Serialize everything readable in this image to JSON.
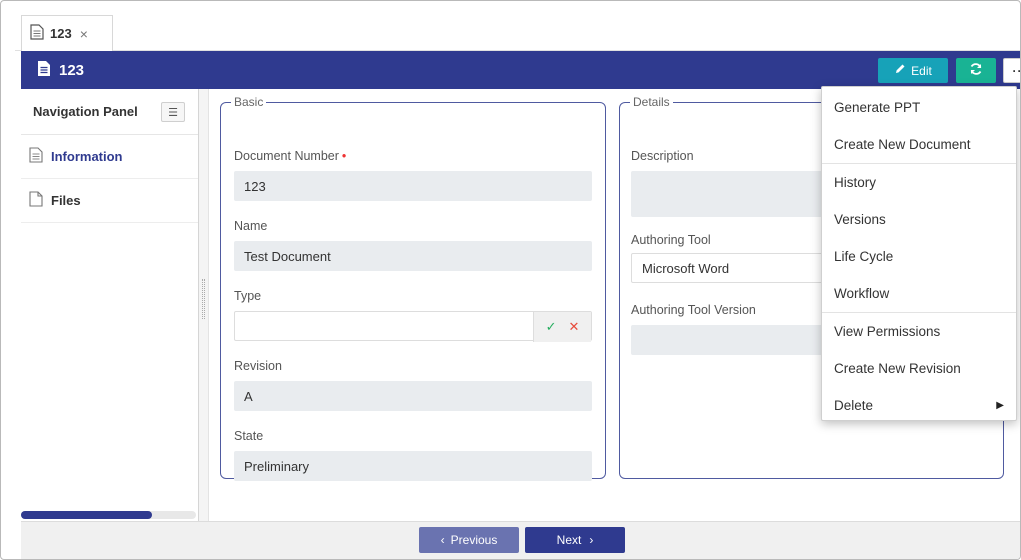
{
  "tab": {
    "title": "123",
    "close": "×"
  },
  "header": {
    "title": "123",
    "edit_label": "Edit",
    "more_label": "···"
  },
  "nav": {
    "title": "Navigation Panel",
    "toggle_icon": "☰",
    "items": [
      {
        "label": "Information",
        "icon": "document-icon",
        "active": true
      },
      {
        "label": "Files",
        "icon": "file-icon",
        "active": false
      }
    ],
    "scroll_progress": 0.75
  },
  "basic": {
    "legend": "Basic",
    "fields": {
      "document_number": {
        "label": "Document Number",
        "required": "•",
        "value": "123"
      },
      "name": {
        "label": "Name",
        "value": "Test Document"
      },
      "type": {
        "label": "Type",
        "value": "",
        "ok": "✓",
        "cancel": "✕"
      },
      "revision": {
        "label": "Revision",
        "value": "A"
      },
      "state": {
        "label": "State",
        "value": "Preliminary"
      }
    }
  },
  "details": {
    "legend": "Details",
    "fields": {
      "description": {
        "label": "Description",
        "value": ""
      },
      "authoring_tool": {
        "label": "Authoring Tool",
        "value": "Microsoft Word"
      },
      "authoring_tool_version": {
        "label": "Authoring Tool Version",
        "value": ""
      }
    }
  },
  "footer": {
    "prev_label": "Previous",
    "prev_glyph": "‹",
    "next_label": "Next",
    "next_glyph": "›"
  },
  "menu": {
    "items": [
      {
        "label": "Generate PPT"
      },
      {
        "label": "Create New Document"
      },
      {
        "label": "History"
      },
      {
        "label": "Versions"
      },
      {
        "label": "Life Cycle"
      },
      {
        "label": "Workflow"
      },
      {
        "label": "View Permissions"
      },
      {
        "label": "Create New Revision"
      },
      {
        "label": "Delete",
        "caret": "▶"
      }
    ]
  },
  "colors": {
    "primary": "#2f3a8f",
    "edit": "#17a2b8",
    "refresh": "#19b394",
    "required": "#e33333"
  }
}
